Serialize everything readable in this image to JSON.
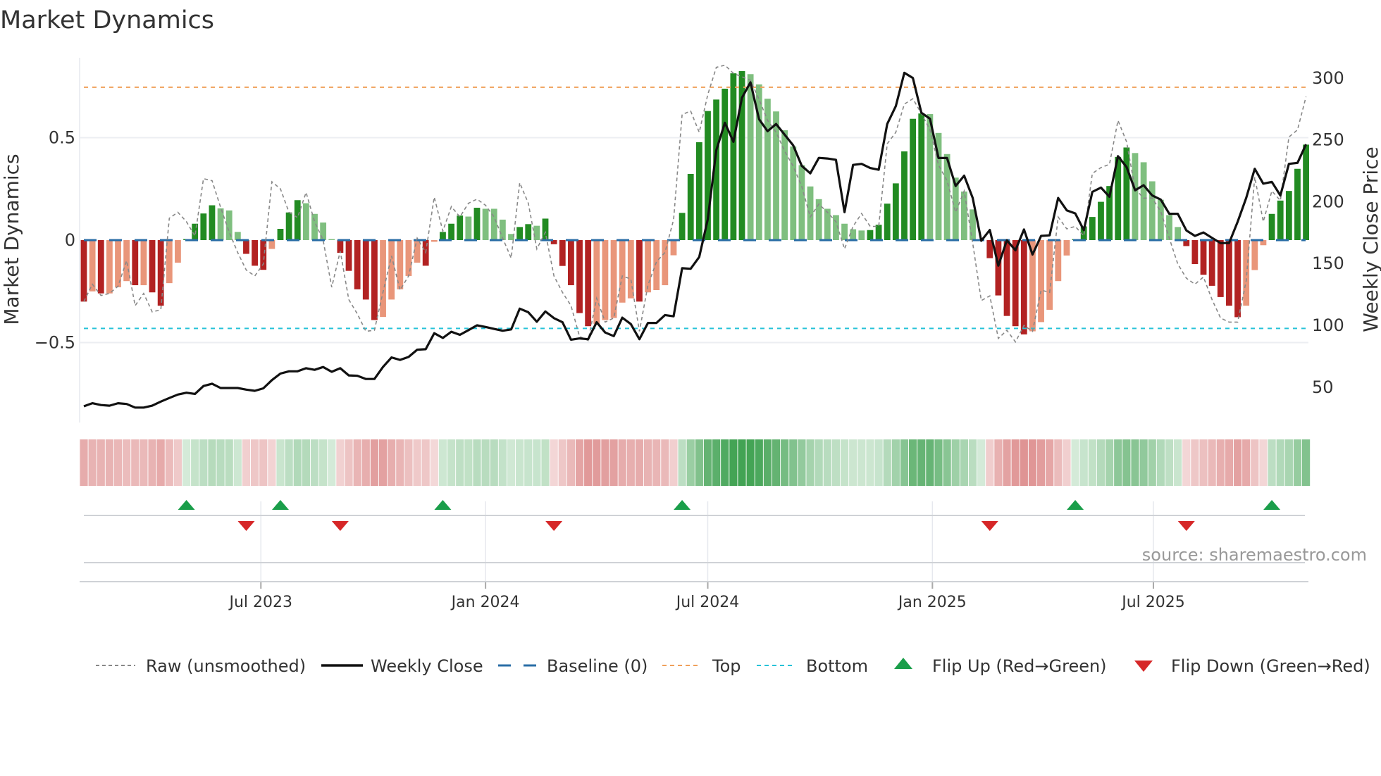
{
  "title": "Market Dynamics",
  "source": "source: sharemaestro.com",
  "legend": {
    "raw": "Raw (unsmoothed)",
    "close": "Weekly Close",
    "baseline": "Baseline (0)",
    "top": "Top",
    "bottom": "Bottom",
    "flip_up": "Flip Up (Red→Green)",
    "flip_down": "Flip Down (Green→Red)"
  },
  "colors": {
    "neg_strong": "#b22222",
    "neg_weak": "#e9967a",
    "pos_strong": "#228b22",
    "pos_weak": "#7fbf7f",
    "baseline": "#2a6ea6",
    "top": "#f0a05a",
    "bottom": "#26c2d8",
    "raw": "#888888",
    "close": "#111111",
    "flip_up": "#1a9e4a",
    "flip_down": "#d62728"
  },
  "chart_data": {
    "type": "bar",
    "title": "Market Dynamics",
    "ylabel": "Market Dynamics",
    "ylabel_right": "Weekly Close Price",
    "ylim": [
      -0.89,
      0.89
    ],
    "ylim_right": [
      21.4,
      316.4
    ],
    "yticks": [
      {
        "v": 0.5,
        "label": "0.5"
      },
      {
        "v": 0,
        "label": "0"
      },
      {
        "v": -0.5,
        "label": "−0.5"
      }
    ],
    "yticks_right": [
      {
        "v": 300,
        "label": "300"
      },
      {
        "v": 250,
        "label": "250"
      },
      {
        "v": 200,
        "label": "200"
      },
      {
        "v": 150,
        "label": "150"
      },
      {
        "v": 100,
        "label": "100"
      },
      {
        "v": 50,
        "label": "50"
      }
    ],
    "xticks": [
      {
        "date": "2023-07-01",
        "label": "Jul 2023"
      },
      {
        "date": "2024-01-01",
        "label": "Jan 2024"
      },
      {
        "date": "2024-07-01",
        "label": "Jul 2024"
      },
      {
        "date": "2025-01-01",
        "label": "Jan 2025"
      },
      {
        "date": "2025-07-01",
        "label": "Jul 2025"
      }
    ],
    "x_start": "2023-02-06",
    "x_frequency": "weekly",
    "grid": true,
    "legend_position": "bottom",
    "top_level": 0.746,
    "bottom_level": -0.431,
    "baseline": 0,
    "histogram": [
      -0.3,
      -0.25,
      -0.26,
      -0.26,
      -0.23,
      -0.2,
      -0.22,
      -0.22,
      -0.255,
      -0.32,
      -0.21,
      -0.11,
      0.005,
      0.08,
      0.13,
      0.17,
      0.155,
      0.145,
      0.04,
      -0.067,
      -0.125,
      -0.145,
      -0.043,
      0.055,
      0.135,
      0.195,
      0.18,
      0.128,
      0.086,
      0.005,
      -0.062,
      -0.15,
      -0.24,
      -0.29,
      -0.39,
      -0.375,
      -0.29,
      -0.24,
      -0.175,
      -0.11,
      -0.125,
      -0.008,
      0.04,
      0.08,
      0.12,
      0.115,
      0.158,
      0.153,
      0.153,
      0.1,
      0.03,
      0.064,
      0.078,
      0.07,
      0.105,
      -0.02,
      -0.126,
      -0.22,
      -0.356,
      -0.42,
      -0.41,
      -0.39,
      -0.38,
      -0.305,
      -0.284,
      -0.3,
      -0.255,
      -0.244,
      -0.22,
      -0.074,
      0.133,
      0.323,
      0.478,
      0.63,
      0.686,
      0.739,
      0.814,
      0.825,
      0.81,
      0.76,
      0.69,
      0.628,
      0.536,
      0.457,
      0.366,
      0.262,
      0.2,
      0.153,
      0.122,
      0.08,
      0.053,
      0.047,
      0.049,
      0.075,
      0.178,
      0.277,
      0.433,
      0.592,
      0.618,
      0.615,
      0.523,
      0.42,
      0.305,
      0.237,
      0.15,
      0.005,
      -0.088,
      -0.27,
      -0.37,
      -0.42,
      -0.46,
      -0.445,
      -0.4,
      -0.34,
      -0.2,
      -0.075,
      0.005,
      0.067,
      0.113,
      0.187,
      0.264,
      0.406,
      0.452,
      0.425,
      0.38,
      0.287,
      0.197,
      0.122,
      0.064,
      -0.029,
      -0.117,
      -0.169,
      -0.223,
      -0.278,
      -0.32,
      -0.376,
      -0.32,
      -0.146,
      -0.025,
      0.128,
      0.193,
      0.24,
      0.348,
      0.466
    ],
    "raw": [
      -0.3,
      -0.215,
      -0.27,
      -0.26,
      -0.225,
      -0.1,
      -0.32,
      -0.26,
      -0.35,
      -0.34,
      0.107,
      0.136,
      0.09,
      0.02,
      0.3,
      0.29,
      0.16,
      0.04,
      -0.06,
      -0.146,
      -0.175,
      -0.117,
      0.285,
      0.25,
      0.136,
      0.11,
      0.233,
      0.09,
      0.0,
      -0.23,
      -0.054,
      -0.29,
      -0.36,
      -0.445,
      -0.44,
      -0.255,
      -0.077,
      -0.244,
      -0.175,
      0.01,
      -0.06,
      0.21,
      0.044,
      0.164,
      0.113,
      0.18,
      0.2,
      0.17,
      0.113,
      0.01,
      -0.088,
      0.28,
      0.18,
      -0.043,
      0.038,
      -0.175,
      -0.255,
      -0.32,
      -0.47,
      -0.49,
      -0.284,
      -0.4,
      -0.38,
      -0.175,
      -0.19,
      -0.445,
      -0.22,
      -0.106,
      -0.06,
      0.1,
      0.613,
      0.63,
      0.526,
      0.71,
      0.843,
      0.854,
      0.814,
      0.797,
      0.78,
      0.687,
      0.584,
      0.526,
      0.434,
      0.36,
      0.262,
      0.113,
      0.176,
      0.136,
      0.09,
      -0.043,
      0.067,
      0.13,
      0.067,
      0.067,
      0.47,
      0.526,
      0.664,
      0.69,
      0.618,
      0.538,
      0.366,
      0.29,
      0.136,
      0.24,
      -0.014,
      -0.295,
      -0.272,
      -0.48,
      -0.44,
      -0.497,
      -0.416,
      -0.445,
      -0.244,
      -0.255,
      0.113,
      0.055,
      0.067,
      0.02,
      0.325,
      0.354,
      0.37,
      0.584,
      0.48,
      0.25,
      0.205,
      0.205,
      0.14,
      0.01,
      -0.117,
      -0.186,
      -0.215,
      -0.18,
      -0.29,
      -0.38,
      -0.4,
      -0.4,
      -0.198,
      0.308,
      0.09,
      0.24,
      0.193,
      0.503,
      0.538,
      0.7
    ],
    "weekly_close": [
      34.5,
      37,
      35.5,
      35,
      37,
      36.4,
      33.5,
      33.5,
      35,
      38.3,
      41.2,
      44,
      45.5,
      44.5,
      50.9,
      52.8,
      49.3,
      49.3,
      49.3,
      48,
      47,
      49,
      55.7,
      61,
      62.8,
      62.8,
      65.3,
      64,
      66.3,
      62.4,
      65.3,
      59.5,
      59.2,
      56.6,
      56.6,
      66.3,
      74,
      72,
      74.4,
      80.3,
      80.7,
      93.6,
      89.8,
      94.8,
      92.3,
      96.1,
      100,
      98.7,
      97.1,
      95.6,
      96.7,
      113.5,
      110.6,
      102.9,
      111.2,
      105.8,
      102.5,
      88.4,
      89.4,
      88.8,
      102.5,
      94.2,
      91.3,
      106.2,
      101,
      88.8,
      101.9,
      101.9,
      108.3,
      107.3,
      146.2,
      145.7,
      155.3,
      185.7,
      241.6,
      263.8,
      248.4,
      284,
      296.5,
      266.7,
      257,
      262.8,
      254.1,
      245.5,
      229,
      222.9,
      235.4,
      234.9,
      233.9,
      191.5,
      229.7,
      230.6,
      227.2,
      225.8,
      262.8,
      277.3,
      304.2,
      300,
      271.9,
      267,
      235.3,
      235.3,
      212.7,
      221,
      203,
      168.4,
      177.1,
      148.2,
      168.8,
      160.7,
      177.5,
      157.2,
      172.3,
      172.8,
      203,
      193,
      190.5,
      177,
      207.9,
      211.4,
      204,
      236.8,
      228,
      209.2,
      213.3,
      205,
      201.7,
      190.2,
      190.2,
      176.7,
      172.3,
      175.1,
      170.7,
      166.5,
      166.5,
      183.8,
      203,
      226.6,
      214.6,
      216,
      205,
      230.6,
      231.4,
      246.4
    ],
    "flip_up_indices": [
      12,
      23,
      42,
      70,
      116,
      139
    ],
    "flip_down_indices": [
      19,
      30,
      55,
      106,
      129
    ]
  }
}
